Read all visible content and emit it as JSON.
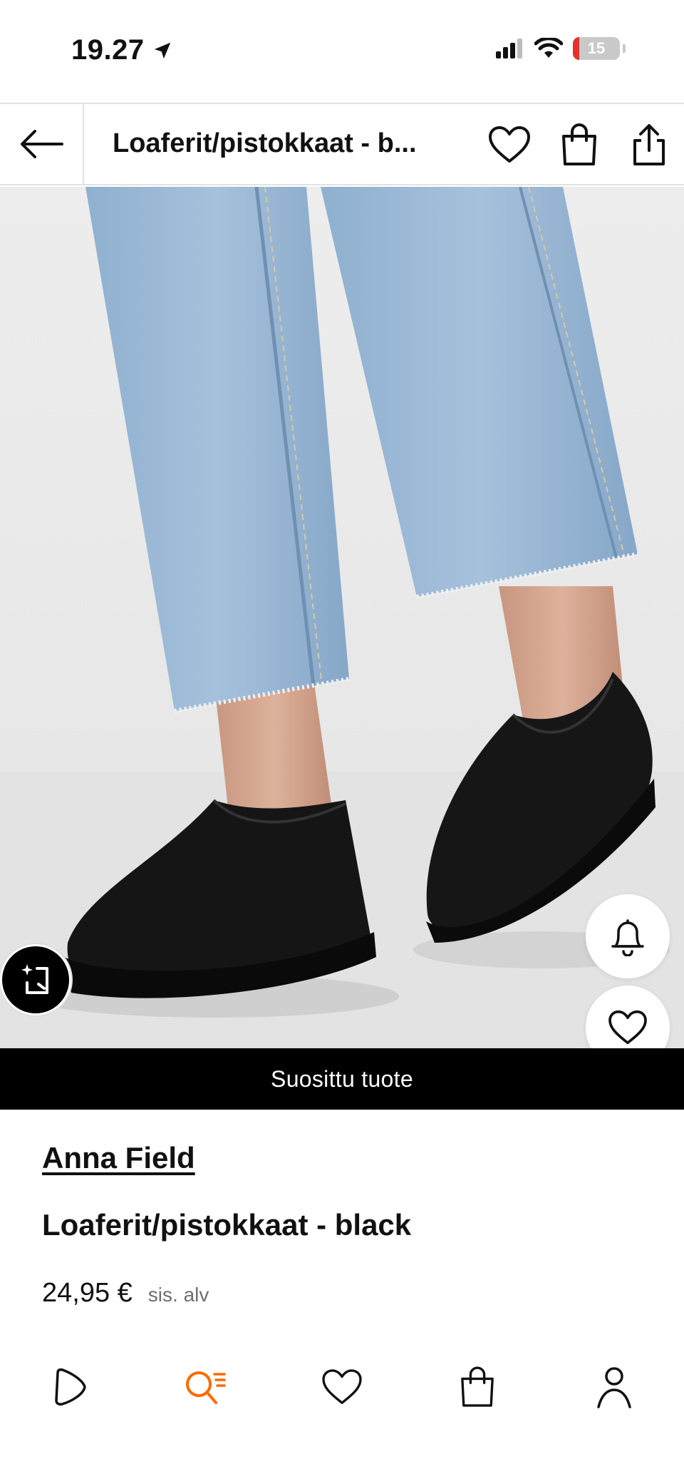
{
  "status_bar": {
    "time": "19.27",
    "battery_level": "15",
    "icons": [
      "location-arrow-icon",
      "cellular-signal-icon",
      "wifi-icon",
      "battery-icon"
    ]
  },
  "header": {
    "title": "Loaferit/pistokkaat - b...",
    "icons": [
      "back-arrow-icon",
      "heart-icon",
      "shopping-bag-icon",
      "share-icon"
    ]
  },
  "product_image": {
    "floating_buttons": [
      "bell-icon",
      "heart-icon",
      "ai-sparkle-icon"
    ]
  },
  "banner": {
    "label": "Suosittu tuote"
  },
  "product": {
    "brand": "Anna Field",
    "title": "Loaferit/pistokkaat - black",
    "price": "24,95 €",
    "vat_note": "sis. alv"
  },
  "bottom_nav": {
    "items": [
      "home-play-icon",
      "search-list-icon",
      "wishlist-heart-icon",
      "cart-bag-icon",
      "profile-icon"
    ],
    "active_item": "search-list-icon",
    "active_color": "#ff6900"
  },
  "colors": {
    "banner_background": "#000000",
    "accent": "#ff6900",
    "battery_low": "#e5322d"
  }
}
